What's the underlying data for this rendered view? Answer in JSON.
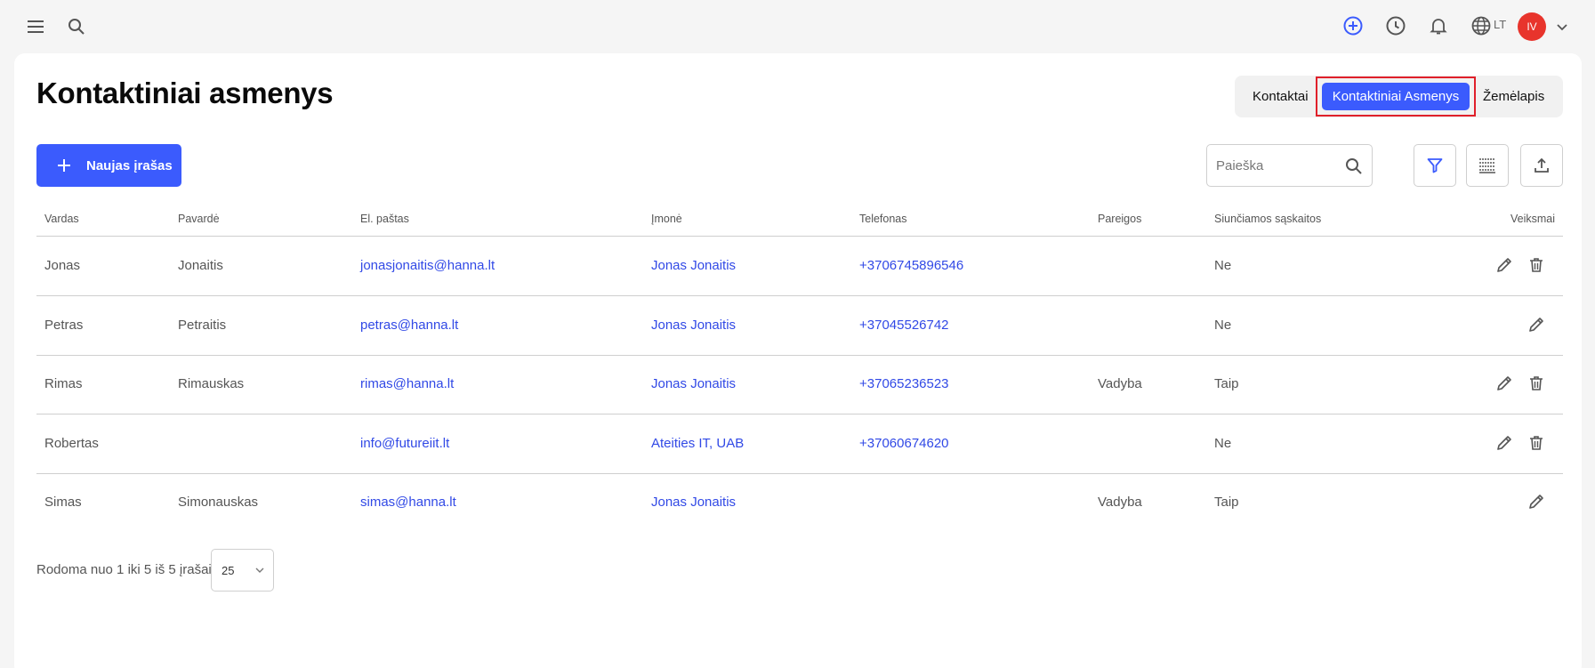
{
  "topbar": {
    "language": "LT",
    "avatar_initials": "IV",
    "icons": [
      "menu-icon",
      "search-icon",
      "add-circle-icon",
      "clock-icon",
      "bell-icon",
      "globe-icon",
      "chevron-down-icon"
    ]
  },
  "page": {
    "title": "Kontaktiniai asmenys"
  },
  "tabs": {
    "items": [
      "Kontaktai",
      "Kontaktiniai Asmenys",
      "Žemėlapis"
    ],
    "active": "Kontaktiniai Asmenys"
  },
  "toolbar": {
    "new_label": "Naujas įrašas",
    "search_placeholder": "Paieška"
  },
  "table": {
    "columns": [
      "Vardas",
      "Pavardė",
      "El. paštas",
      "Įmonė",
      "Telefonas",
      "Pareigos",
      "Siunčiamos sąskaitos",
      "Veiksmai"
    ],
    "rows": [
      {
        "vardas": "Jonas",
        "pavarde": "Jonaitis",
        "email": "jonasjonaitis@hanna.lt",
        "imone": "Jonas Jonaitis",
        "telefonas": "+3706745896546",
        "pareigos": "",
        "saskaitos": "Ne",
        "can_delete": true
      },
      {
        "vardas": "Petras",
        "pavarde": "Petraitis",
        "email": "petras@hanna.lt",
        "imone": "Jonas Jonaitis",
        "telefonas": "+37045526742",
        "pareigos": "",
        "saskaitos": "Ne",
        "can_delete": false
      },
      {
        "vardas": "Rimas",
        "pavarde": "Rimauskas",
        "email": "rimas@hanna.lt",
        "imone": "Jonas Jonaitis",
        "telefonas": "+37065236523",
        "pareigos": "Vadyba",
        "saskaitos": "Taip",
        "can_delete": true
      },
      {
        "vardas": "Robertas",
        "pavarde": "",
        "email": "info@futureiit.lt",
        "imone": "Ateities IT, UAB",
        "telefonas": "+37060674620",
        "pareigos": "",
        "saskaitos": "Ne",
        "can_delete": true
      },
      {
        "vardas": "Simas",
        "pavarde": "Simonauskas",
        "email": "simas@hanna.lt",
        "imone": "Jonas Jonaitis",
        "telefonas": "",
        "pareigos": "Vadyba",
        "saskaitos": "Taip",
        "can_delete": false
      }
    ]
  },
  "footer": {
    "summary": "Rodoma nuo 1 iki 5 iš 5 įrašai",
    "page_size": "25"
  },
  "colors": {
    "accent": "#3b5bfd",
    "link": "#3149e6",
    "avatar_bg": "#e8342c",
    "highlight": "#e0202a"
  }
}
